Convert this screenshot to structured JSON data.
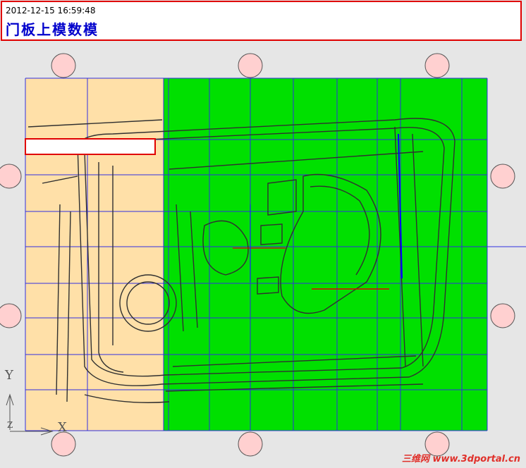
{
  "header": {
    "timestamp": "2012-12-15 16:59:48",
    "title": "门板上模数模"
  },
  "label_box": {
    "text": ""
  },
  "axes": {
    "x": "X",
    "y": "Y",
    "z": "Z"
  },
  "watermark": "三维网 www.3dportal.cn",
  "colors": {
    "highlight_border": "#e00000",
    "title_text": "#0000cc",
    "green_region": "#00e000",
    "beige_region": "#ffe0a8",
    "grid_lines": "#3030e0",
    "locator_circles": "#ffd0d0"
  }
}
